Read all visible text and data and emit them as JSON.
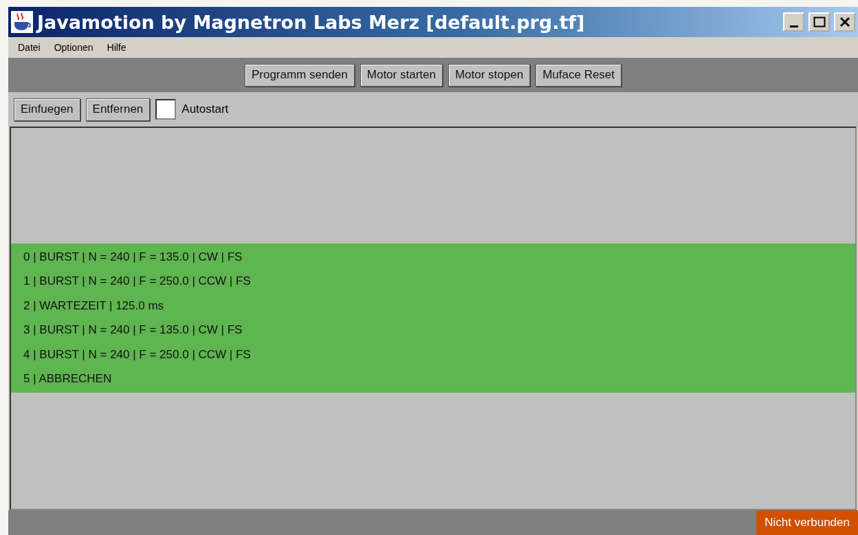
{
  "window": {
    "title": "Javamotion by Magnetron Labs Merz [default.prg.tf]"
  },
  "menu": [
    "Datei",
    "Optionen",
    "Hilfe"
  ],
  "toolbar": [
    "Programm senden",
    "Motor starten",
    "Motor stopen",
    "Muface Reset"
  ],
  "edit_bar": {
    "buttons": [
      "Einfuegen",
      "Entfernen"
    ],
    "autostart": {
      "label": "Autostart",
      "checked": false
    }
  },
  "program": [
    {
      "text": "0 | BURST | N = 240 | F = 135.0 | CW | FS"
    },
    {
      "text": "1 | BURST | N = 240 | F = 250.0 | CCW | FS"
    },
    {
      "text": "2 | WARTEZEIT | 125.0 ms"
    },
    {
      "text": "3 | BURST | N = 240 | F = 135.0 | CW | FS"
    },
    {
      "text": "4 | BURST | N = 240 | F = 250.0 | CCW | FS"
    },
    {
      "text": "5 | ABBRECHEN"
    }
  ],
  "status_bar": {
    "connection": "Nicht verbunden"
  }
}
